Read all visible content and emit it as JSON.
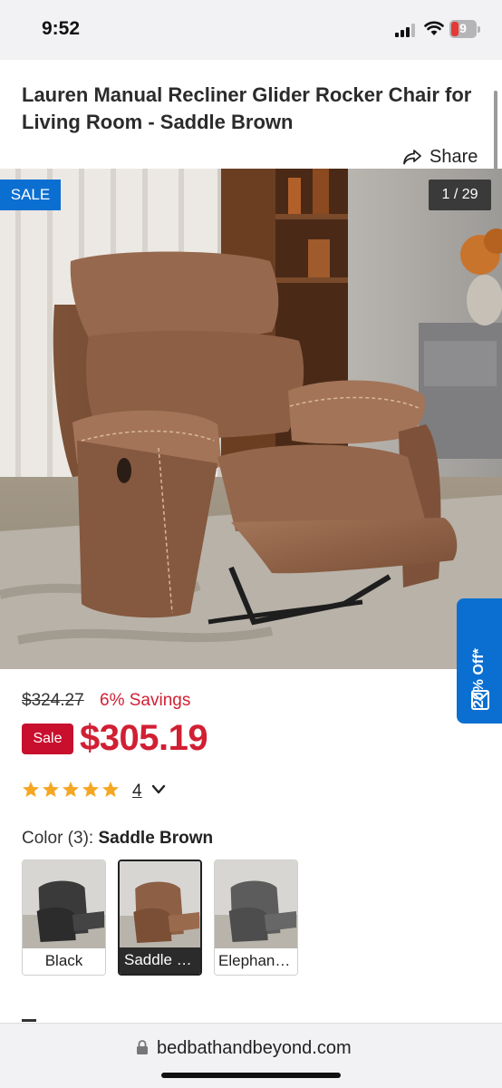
{
  "status_bar": {
    "time": "9:52",
    "battery_level": "9",
    "icons": [
      "signal-icon",
      "wifi-icon",
      "battery-icon"
    ]
  },
  "product": {
    "title": "Lauren Manual Recliner Glider Rocker Chair for Living Room - Saddle Brown",
    "share_label": "Share"
  },
  "gallery": {
    "sale_flag": "SALE",
    "counter": "1 / 29",
    "promo_label": "20% Off*"
  },
  "pricing": {
    "original_price": "$324.27",
    "savings": "6% Savings",
    "sale_badge": "Sale",
    "sale_price": "$305.19"
  },
  "rating": {
    "stars": 5,
    "review_count": "4"
  },
  "color": {
    "label_prefix": "Color (3):",
    "selected_name": "Saddle Brown",
    "swatches": [
      {
        "label": "Black",
        "selected": false
      },
      {
        "label": "Saddle Brown",
        "selected": true
      },
      {
        "label": "Elephant Grey",
        "selected": false
      }
    ]
  },
  "url_bar": {
    "url": "bedbathandbeyond.com"
  },
  "colors": {
    "accent_blue": "#0b6fd1",
    "sale_red": "#d11f33",
    "star_orange": "#f5a623"
  }
}
